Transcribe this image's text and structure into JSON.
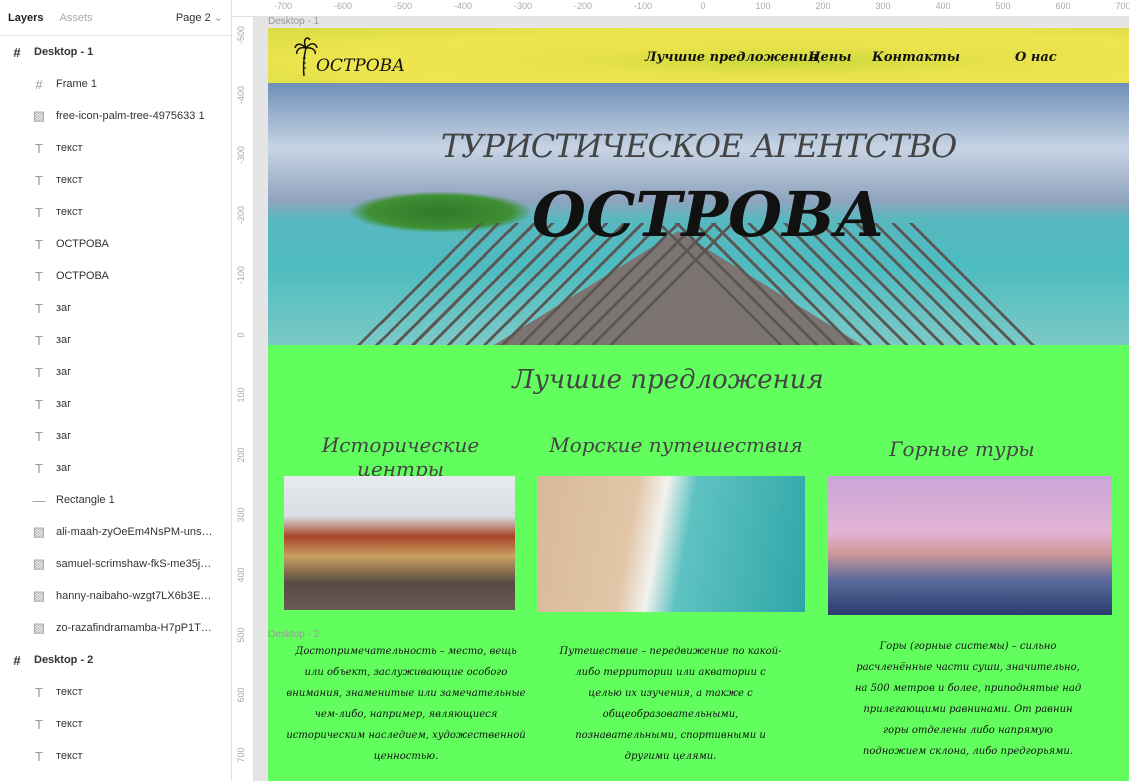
{
  "panel": {
    "tab_layers": "Layers",
    "tab_assets": "Assets",
    "page": "Page 2",
    "layers": [
      {
        "name": "Desktop - 1",
        "type": "frame",
        "top": true
      },
      {
        "name": "Frame 1",
        "type": "frame"
      },
      {
        "name": "free-icon-palm-tree-4975633 1",
        "type": "image"
      },
      {
        "name": "текст",
        "type": "text"
      },
      {
        "name": "текст",
        "type": "text"
      },
      {
        "name": "текст",
        "type": "text"
      },
      {
        "name": "ОСТРОВА",
        "type": "text"
      },
      {
        "name": "ОСТРОВА",
        "type": "text"
      },
      {
        "name": "заг",
        "type": "text"
      },
      {
        "name": "заг",
        "type": "text"
      },
      {
        "name": "заг",
        "type": "text"
      },
      {
        "name": "заг",
        "type": "text"
      },
      {
        "name": "заг",
        "type": "text"
      },
      {
        "name": "заг",
        "type": "text"
      },
      {
        "name": "Rectangle 1",
        "type": "rect"
      },
      {
        "name": "ali-maah-zyOeEm4NsPM-uns…",
        "type": "image"
      },
      {
        "name": "samuel-scrimshaw-fkS-me35j…",
        "type": "image"
      },
      {
        "name": "hanny-naibaho-wzgt7LX6b3E…",
        "type": "image"
      },
      {
        "name": "zo-razafindramamba-H7pP1T…",
        "type": "image"
      },
      {
        "name": "Desktop - 2",
        "type": "frame",
        "top": true
      },
      {
        "name": "текст",
        "type": "text"
      },
      {
        "name": "текст",
        "type": "text"
      },
      {
        "name": "текст",
        "type": "text"
      }
    ]
  },
  "ruler": {
    "top": [
      "-700",
      "-600",
      "-500",
      "-400",
      "-300",
      "-200",
      "-100",
      "0",
      "100",
      "200",
      "300",
      "400",
      "500",
      "600",
      "700"
    ],
    "left": [
      "-500",
      "-400",
      "-300",
      "-200",
      "-100",
      "0",
      "100",
      "200",
      "300",
      "400",
      "500",
      "600",
      "700"
    ]
  },
  "canvas": {
    "frame1_label": "Desktop - 1",
    "frame2_label": "Desktop - 2"
  },
  "site": {
    "logo": "ОСТРОВА",
    "nav": [
      "Лучшие предложения",
      "Цены",
      "Контакты",
      "О нас"
    ],
    "hero_sub": "ТУРИСТИЧЕСКОЕ АГЕНТСТВО",
    "hero_title": "ОСТРОВА",
    "section_title": "Лучшие предложения",
    "cards": [
      {
        "title": "Исторические центры",
        "text": "Достопримечательность – место, вещь или объект, заслуживающие особого внимания, знаменитые или замечательные чем-либо, например, являющиеся историческим наследием, художественной ценностью."
      },
      {
        "title": "Морские путешествия",
        "text": "Путешествие – передвижение по какой-либо территории или акватории с целью их изучения, а также с общеобразовательными, познавательными, спортивными и другими целями."
      },
      {
        "title": "Горные туры",
        "text": "Горы (горные системы) – сильно расчленённые части суши, значительно, на 500 метров и более, приподнятые над прилегающими равнинами. От равнин горы отделены либо напрямую подножием склона, либо предгорьями."
      }
    ]
  }
}
